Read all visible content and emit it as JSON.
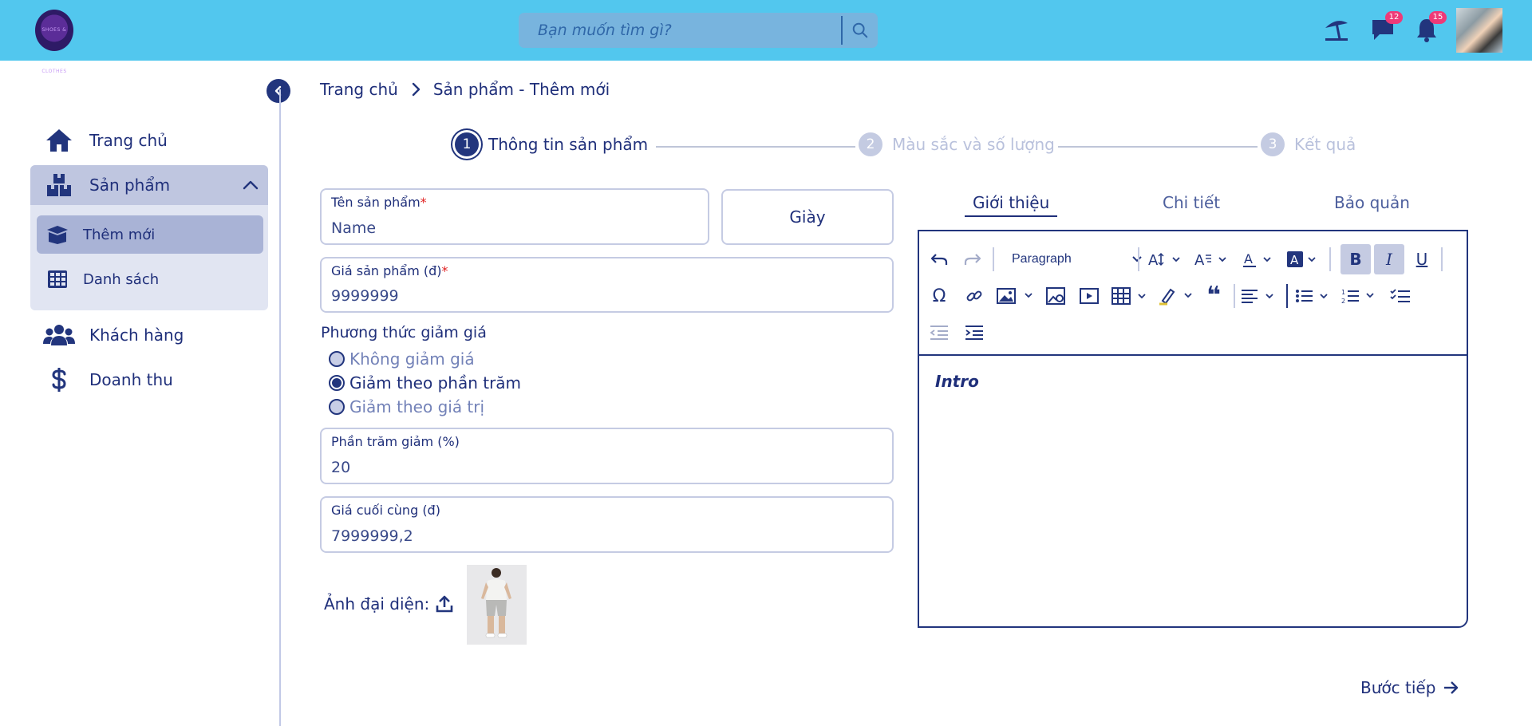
{
  "header": {
    "logo_text": "SHOES & CLOTHES",
    "search_placeholder": "Bạn muốn tìm gì?",
    "messages_badge": "12",
    "notifications_badge": "15",
    "colors": {
      "bar": "#52c7ee",
      "badge": "#ee3a78"
    }
  },
  "sidebar": {
    "items": [
      {
        "label": "Trang chủ",
        "icon": "home-icon"
      },
      {
        "label": "Sản phẩm",
        "icon": "boxes-icon",
        "expanded": true,
        "children": [
          {
            "label": "Thêm mới",
            "icon": "open-box-icon",
            "active": true
          },
          {
            "label": "Danh sách",
            "icon": "grid-icon"
          }
        ]
      },
      {
        "label": "Khách hàng",
        "icon": "users-icon"
      },
      {
        "label": "Doanh thu",
        "icon": "dollar-icon"
      }
    ]
  },
  "breadcrumb": {
    "home": "Trang chủ",
    "current": "Sản phẩm - Thêm mới"
  },
  "stepper": [
    {
      "number": "1",
      "label": "Thông tin sản phẩm",
      "active": true
    },
    {
      "number": "2",
      "label": "Màu sắc và số lượng",
      "active": false
    },
    {
      "number": "3",
      "label": "Kết quả",
      "active": false
    }
  ],
  "form": {
    "name": {
      "label": "Tên sản phẩm",
      "required_mark": "*",
      "placeholder": "Name"
    },
    "category": {
      "value": "Giày"
    },
    "price": {
      "label": "Giá sản phẩm (đ)",
      "required_mark": "*",
      "value": "9999999"
    },
    "discount": {
      "title": "Phương thức giảm giá",
      "options": [
        {
          "label": "Không giảm giá",
          "checked": false
        },
        {
          "label": "Giảm theo phần trăm",
          "checked": true
        },
        {
          "label": "Giảm theo giá trị",
          "checked": false
        }
      ]
    },
    "discount_percent": {
      "label": "Phần trăm giảm (%)",
      "value": "20"
    },
    "final_price": {
      "label": "Giá cuối cùng (đ)",
      "value": "7999999,2"
    },
    "avatar_label": "Ảnh đại diện:"
  },
  "editor": {
    "tabs": [
      {
        "label": "Giới thiệu",
        "active": true
      },
      {
        "label": "Chi tiết",
        "active": false
      },
      {
        "label": "Bảo quản",
        "active": false
      }
    ],
    "heading_select": "Paragraph",
    "content": "Intro"
  },
  "next_button": "Bước tiếp"
}
